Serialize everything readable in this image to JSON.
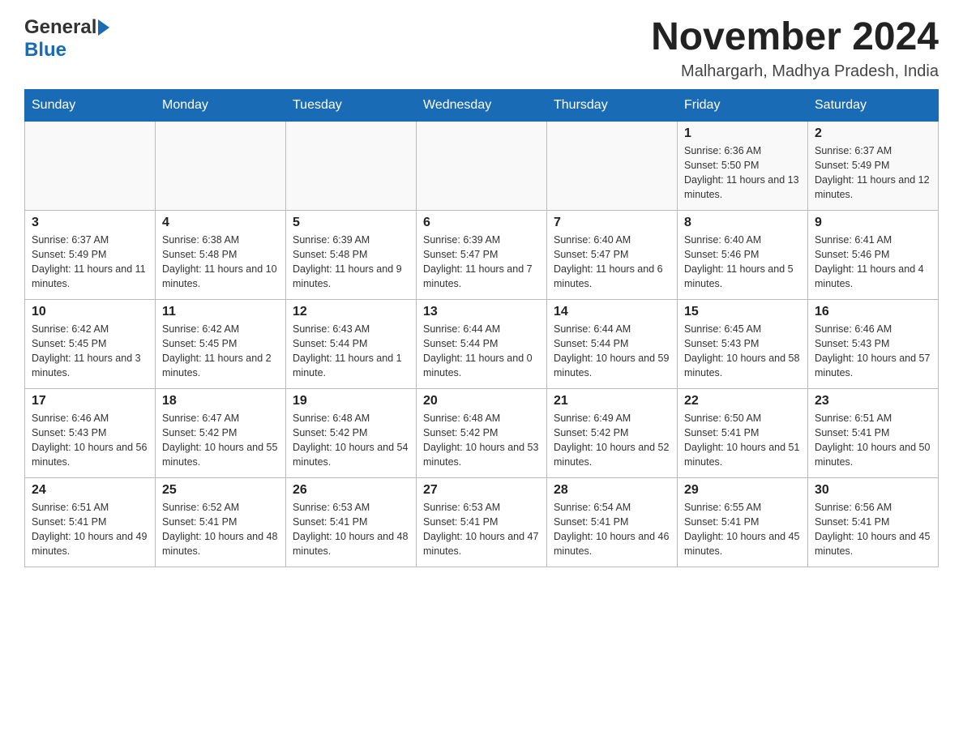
{
  "header": {
    "logo_general": "General",
    "logo_blue": "Blue",
    "month_title": "November 2024",
    "location": "Malhargarh, Madhya Pradesh, India"
  },
  "days_of_week": [
    "Sunday",
    "Monday",
    "Tuesday",
    "Wednesday",
    "Thursday",
    "Friday",
    "Saturday"
  ],
  "weeks": [
    [
      {
        "day": "",
        "sunrise": "",
        "sunset": "",
        "daylight": ""
      },
      {
        "day": "",
        "sunrise": "",
        "sunset": "",
        "daylight": ""
      },
      {
        "day": "",
        "sunrise": "",
        "sunset": "",
        "daylight": ""
      },
      {
        "day": "",
        "sunrise": "",
        "sunset": "",
        "daylight": ""
      },
      {
        "day": "",
        "sunrise": "",
        "sunset": "",
        "daylight": ""
      },
      {
        "day": "1",
        "sunrise": "Sunrise: 6:36 AM",
        "sunset": "Sunset: 5:50 PM",
        "daylight": "Daylight: 11 hours and 13 minutes."
      },
      {
        "day": "2",
        "sunrise": "Sunrise: 6:37 AM",
        "sunset": "Sunset: 5:49 PM",
        "daylight": "Daylight: 11 hours and 12 minutes."
      }
    ],
    [
      {
        "day": "3",
        "sunrise": "Sunrise: 6:37 AM",
        "sunset": "Sunset: 5:49 PM",
        "daylight": "Daylight: 11 hours and 11 minutes."
      },
      {
        "day": "4",
        "sunrise": "Sunrise: 6:38 AM",
        "sunset": "Sunset: 5:48 PM",
        "daylight": "Daylight: 11 hours and 10 minutes."
      },
      {
        "day": "5",
        "sunrise": "Sunrise: 6:39 AM",
        "sunset": "Sunset: 5:48 PM",
        "daylight": "Daylight: 11 hours and 9 minutes."
      },
      {
        "day": "6",
        "sunrise": "Sunrise: 6:39 AM",
        "sunset": "Sunset: 5:47 PM",
        "daylight": "Daylight: 11 hours and 7 minutes."
      },
      {
        "day": "7",
        "sunrise": "Sunrise: 6:40 AM",
        "sunset": "Sunset: 5:47 PM",
        "daylight": "Daylight: 11 hours and 6 minutes."
      },
      {
        "day": "8",
        "sunrise": "Sunrise: 6:40 AM",
        "sunset": "Sunset: 5:46 PM",
        "daylight": "Daylight: 11 hours and 5 minutes."
      },
      {
        "day": "9",
        "sunrise": "Sunrise: 6:41 AM",
        "sunset": "Sunset: 5:46 PM",
        "daylight": "Daylight: 11 hours and 4 minutes."
      }
    ],
    [
      {
        "day": "10",
        "sunrise": "Sunrise: 6:42 AM",
        "sunset": "Sunset: 5:45 PM",
        "daylight": "Daylight: 11 hours and 3 minutes."
      },
      {
        "day": "11",
        "sunrise": "Sunrise: 6:42 AM",
        "sunset": "Sunset: 5:45 PM",
        "daylight": "Daylight: 11 hours and 2 minutes."
      },
      {
        "day": "12",
        "sunrise": "Sunrise: 6:43 AM",
        "sunset": "Sunset: 5:44 PM",
        "daylight": "Daylight: 11 hours and 1 minute."
      },
      {
        "day": "13",
        "sunrise": "Sunrise: 6:44 AM",
        "sunset": "Sunset: 5:44 PM",
        "daylight": "Daylight: 11 hours and 0 minutes."
      },
      {
        "day": "14",
        "sunrise": "Sunrise: 6:44 AM",
        "sunset": "Sunset: 5:44 PM",
        "daylight": "Daylight: 10 hours and 59 minutes."
      },
      {
        "day": "15",
        "sunrise": "Sunrise: 6:45 AM",
        "sunset": "Sunset: 5:43 PM",
        "daylight": "Daylight: 10 hours and 58 minutes."
      },
      {
        "day": "16",
        "sunrise": "Sunrise: 6:46 AM",
        "sunset": "Sunset: 5:43 PM",
        "daylight": "Daylight: 10 hours and 57 minutes."
      }
    ],
    [
      {
        "day": "17",
        "sunrise": "Sunrise: 6:46 AM",
        "sunset": "Sunset: 5:43 PM",
        "daylight": "Daylight: 10 hours and 56 minutes."
      },
      {
        "day": "18",
        "sunrise": "Sunrise: 6:47 AM",
        "sunset": "Sunset: 5:42 PM",
        "daylight": "Daylight: 10 hours and 55 minutes."
      },
      {
        "day": "19",
        "sunrise": "Sunrise: 6:48 AM",
        "sunset": "Sunset: 5:42 PM",
        "daylight": "Daylight: 10 hours and 54 minutes."
      },
      {
        "day": "20",
        "sunrise": "Sunrise: 6:48 AM",
        "sunset": "Sunset: 5:42 PM",
        "daylight": "Daylight: 10 hours and 53 minutes."
      },
      {
        "day": "21",
        "sunrise": "Sunrise: 6:49 AM",
        "sunset": "Sunset: 5:42 PM",
        "daylight": "Daylight: 10 hours and 52 minutes."
      },
      {
        "day": "22",
        "sunrise": "Sunrise: 6:50 AM",
        "sunset": "Sunset: 5:41 PM",
        "daylight": "Daylight: 10 hours and 51 minutes."
      },
      {
        "day": "23",
        "sunrise": "Sunrise: 6:51 AM",
        "sunset": "Sunset: 5:41 PM",
        "daylight": "Daylight: 10 hours and 50 minutes."
      }
    ],
    [
      {
        "day": "24",
        "sunrise": "Sunrise: 6:51 AM",
        "sunset": "Sunset: 5:41 PM",
        "daylight": "Daylight: 10 hours and 49 minutes."
      },
      {
        "day": "25",
        "sunrise": "Sunrise: 6:52 AM",
        "sunset": "Sunset: 5:41 PM",
        "daylight": "Daylight: 10 hours and 48 minutes."
      },
      {
        "day": "26",
        "sunrise": "Sunrise: 6:53 AM",
        "sunset": "Sunset: 5:41 PM",
        "daylight": "Daylight: 10 hours and 48 minutes."
      },
      {
        "day": "27",
        "sunrise": "Sunrise: 6:53 AM",
        "sunset": "Sunset: 5:41 PM",
        "daylight": "Daylight: 10 hours and 47 minutes."
      },
      {
        "day": "28",
        "sunrise": "Sunrise: 6:54 AM",
        "sunset": "Sunset: 5:41 PM",
        "daylight": "Daylight: 10 hours and 46 minutes."
      },
      {
        "day": "29",
        "sunrise": "Sunrise: 6:55 AM",
        "sunset": "Sunset: 5:41 PM",
        "daylight": "Daylight: 10 hours and 45 minutes."
      },
      {
        "day": "30",
        "sunrise": "Sunrise: 6:56 AM",
        "sunset": "Sunset: 5:41 PM",
        "daylight": "Daylight: 10 hours and 45 minutes."
      }
    ]
  ]
}
